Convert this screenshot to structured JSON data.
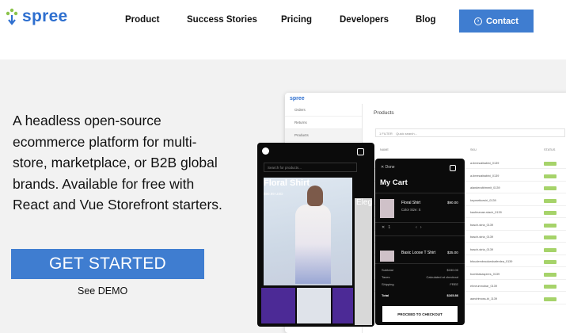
{
  "header": {
    "logo_text": "spree",
    "nav": [
      "Product",
      "Success Stories",
      "Pricing",
      "Developers",
      "Blog"
    ],
    "contact_label": "Contact",
    "contact_icon": "arrow-circle-icon",
    "accent_color": "#3f7dd0"
  },
  "hero": {
    "tagline": "A headless open-source ecommerce platform for multi-store, marketplace, or B2B global brands. Available for free with React and Vue Storefront starters.",
    "cta_label": "GET STARTED",
    "demo_link": "See DEMO"
  },
  "admin_mock": {
    "logo": "spree",
    "sidebar": [
      "Orders",
      "Returns",
      "Products"
    ],
    "title": "Products",
    "filter_label": "1 FILTER",
    "search_placeholder": "Quick search...",
    "columns": [
      "NAME",
      "SKU",
      "STATUS"
    ],
    "skus": [
      "a-timesatbabini_0139",
      "a-timesatbabini_0139",
      "alanderaltrimmit_0139",
      "keymettcesiri_0139",
      "kaufmanae-stach_0139",
      "basch-stria_0139",
      "basch-stria_0139",
      "basch-stria_0139",
      "bfoudembrookesbafenlea_0139",
      "bomblakaspires_0139",
      "ehneumnobar_0139",
      "aandrimoss-kt_1139"
    ]
  },
  "storefront_mock": {
    "search_placeholder": "Search for products...",
    "product_title": "Floral Shirt",
    "product_price": "$90.99 USD",
    "side_label": "Eleg"
  },
  "cart_mock": {
    "close_label": "Done",
    "title": "My Cart",
    "item1_name": "Floral Shirt",
    "item1_meta": "Color  Size: S",
    "item1_price": "$90.00",
    "item2_name": "Basic Loose T Shirt",
    "item2_price": "$35.00",
    "summary": [
      {
        "label": "Subtotal",
        "value": "$150.00"
      },
      {
        "label": "Taxes",
        "value": "Calculated at checkout"
      },
      {
        "label": "Shipping",
        "value": "FREE"
      },
      {
        "label": "Total",
        "value": "$165.86"
      }
    ],
    "checkout_label": "PROCEED TO CHECKOUT"
  }
}
